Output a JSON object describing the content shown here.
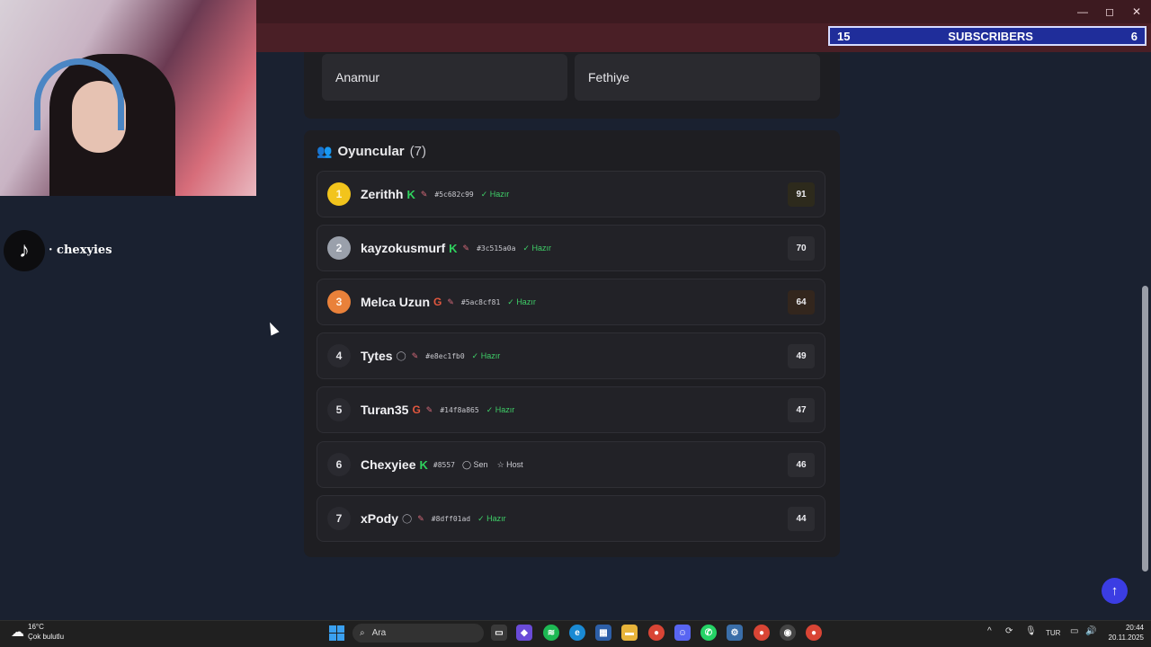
{
  "window": {
    "minimize": "—",
    "maximize": "◻",
    "close": "✕"
  },
  "subscribers": {
    "left": "15",
    "label": "SUBSCRIBERS",
    "right": "6"
  },
  "overlay": {
    "tiktok_handle": "· chexyies"
  },
  "cities": [
    "Anamur",
    "Fethiye"
  ],
  "players_section": {
    "title": "Oyuncular",
    "count": "(7)"
  },
  "players": [
    {
      "rank": "1",
      "name": "Zerithh",
      "badge": "k",
      "role": "icon",
      "tag": "#5c682c99",
      "status": "Hazır",
      "score": "91"
    },
    {
      "rank": "2",
      "name": "kayzokusmurf",
      "badge": "k",
      "role": "icon",
      "tag": "#3c515a0a",
      "status": "Hazır",
      "score": "70"
    },
    {
      "rank": "3",
      "name": "Melca Uzun",
      "badge": "google",
      "role": "icon",
      "tag": "#5ac8cf81",
      "status": "Hazır",
      "score": "64"
    },
    {
      "rank": "4",
      "name": "Tytes",
      "badge": "user",
      "role": "icon",
      "tag": "#e8ec1fb0",
      "status": "Hazır",
      "score": "49"
    },
    {
      "rank": "5",
      "name": "Turan35",
      "badge": "google",
      "role": "icon",
      "tag": "#14f8a865",
      "status": "Hazır",
      "score": "47"
    },
    {
      "rank": "6",
      "name": "Chexyiee",
      "badge": "k",
      "role": "none",
      "tag": "#8557",
      "you_label": "Sen",
      "host_label": "Host",
      "score": "46"
    },
    {
      "rank": "7",
      "name": "xPody",
      "badge": "user",
      "role": "icon",
      "tag": "#8dff01ad",
      "status": "Hazır",
      "score": "44"
    }
  ],
  "taskbar": {
    "weather_temp": "16°C",
    "weather_desc": "Çok bulutlu",
    "search_placeholder": "Ara",
    "language": "TUR",
    "time": "20:44",
    "date": "20.11.2025"
  },
  "colors": {
    "accent_blue": "#3b3de3",
    "ready_green": "#3fcf68",
    "gold": "#f2c41c",
    "silver": "#9aa0ab",
    "bronze": "#e9813a"
  }
}
